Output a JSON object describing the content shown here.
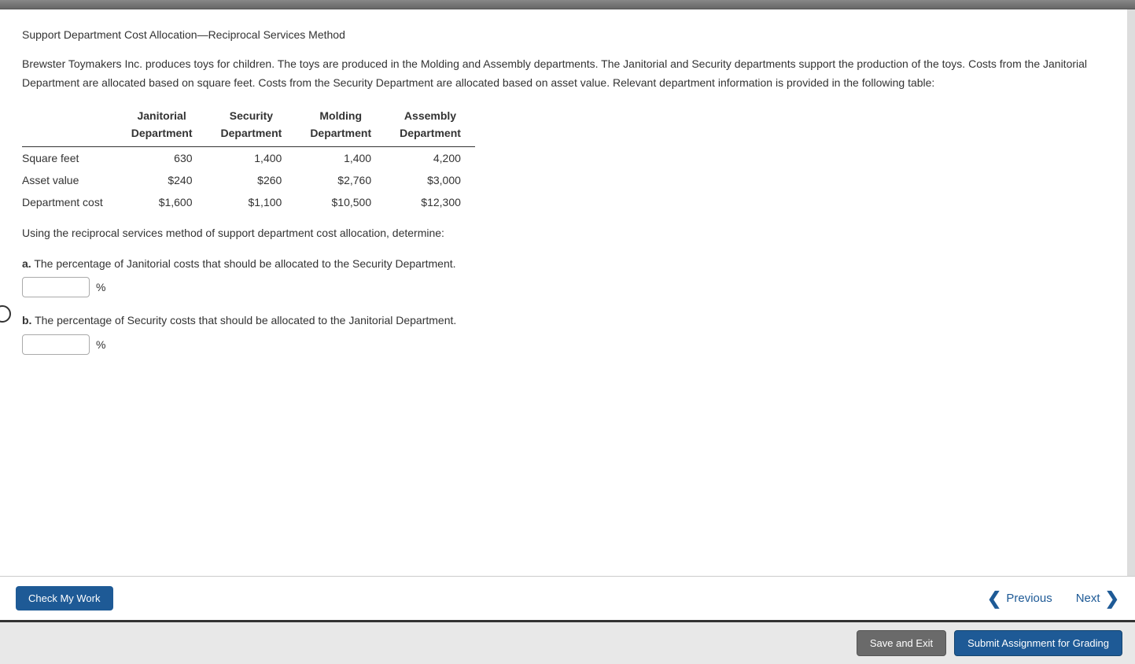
{
  "title": "Support Department Cost Allocation—Reciprocal Services Method",
  "description": "Brewster Toymakers Inc. produces toys for children. The toys are produced in the Molding and Assembly departments. The Janitorial and Security departments support the production of the toys. Costs from the Janitorial Department are allocated based on square feet. Costs from the Security Department are allocated based on asset value. Relevant department information is provided in the following table:",
  "table": {
    "headers": {
      "col1": {
        "line1": "Janitorial",
        "line2": "Department"
      },
      "col2": {
        "line1": "Security",
        "line2": "Department"
      },
      "col3": {
        "line1": "Molding",
        "line2": "Department"
      },
      "col4": {
        "line1": "Assembly",
        "line2": "Department"
      }
    },
    "rows": [
      {
        "label": "Square feet",
        "c1": "630",
        "c2": "1,400",
        "c3": "1,400",
        "c4": "4,200"
      },
      {
        "label": "Asset value",
        "c1": "$240",
        "c2": "$260",
        "c3": "$2,760",
        "c4": "$3,000"
      },
      {
        "label": "Department cost",
        "c1": "$1,600",
        "c2": "$1,100",
        "c3": "$10,500",
        "c4": "$12,300"
      }
    ]
  },
  "instruction": "Using the reciprocal services method of support department cost allocation, determine:",
  "questions": {
    "a": {
      "label": "a.",
      "text": " The percentage of Janitorial costs that should be allocated to the Security Department."
    },
    "b": {
      "label": "b.",
      "text": " The percentage of Security costs that should be allocated to the Janitorial Department."
    }
  },
  "percent_symbol": "%",
  "footer": {
    "check": "Check My Work",
    "previous": "Previous",
    "next": "Next"
  },
  "bottom": {
    "save": "Save and Exit",
    "submit": "Submit Assignment for Grading"
  }
}
